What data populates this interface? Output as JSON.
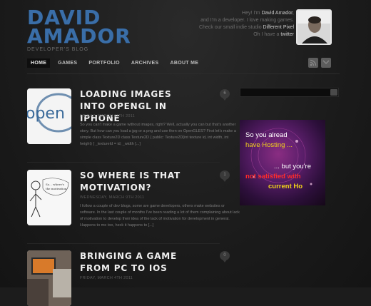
{
  "header": {
    "logo_line1": "DAVID",
    "logo_line2": "AMADOR",
    "tagline": "DEVELOPER'S BLOG",
    "intro_line1_a": "Hey! I'm ",
    "intro_line1_b": "David Amador",
    "intro_line1_c": ",",
    "intro_line2": "and I'm a developer. I love making games.",
    "intro_line3_a": "Check our small indie studio ",
    "intro_line3_b": "Different Pixel",
    "intro_line4_a": "Oh I have a ",
    "intro_line4_b": "twitter"
  },
  "nav": {
    "items": [
      "HOME",
      "GAMES",
      "PORTFOLIO",
      "ARCHIVES",
      "ABOUT ME"
    ],
    "active_index": 0
  },
  "social": {
    "icons": [
      "rss-icon",
      "mail-icon"
    ]
  },
  "posts": [
    {
      "title": "LOADING IMAGES INTO OPENGL IN IPHONE",
      "date": "FRIDAY, MARCH 11TH 2011",
      "excerpt": "So you can't make a game without images, right? Well, actually you can but that's another story. But how can you load a jpg or a png and use then on OpenGLES? First let's make a simple class Texture2D class Texture2D { public: Texture2D(int texture id, int width, int height) { _textureId = id; _width [...]",
      "comments": "6"
    },
    {
      "title": "SO WHERE IS THAT MOTIVATION?",
      "date": "WEDNESDAY, MARCH 9TH 2011",
      "excerpt": "I follow a couple of dev blogs, some are game developers, others make websites or software. In the last couple of months I've been reading a lot of them complaining about lack of motivation to develop their idea of the lack of motivation for development in general. Happens to me too, heck it happens to [...]",
      "comments": "1"
    },
    {
      "title": "BRINGING A GAME FROM PC TO IOS",
      "date": "FRIDAY, MARCH 4TH 2011",
      "excerpt": "",
      "comments": "0"
    }
  ],
  "thumbs": {
    "opengl_text": "open",
    "sketch_caption": "So... where's the motivation..."
  },
  "sidebar": {
    "ad_lines": [
      "So you alread",
      "have Hosting ...",
      "... but you're",
      "not satisfied with",
      "current Ho"
    ]
  },
  "colors": {
    "logo": "#3a6ea8",
    "background": "#1c1c1c",
    "ad_yellow": "#f2d21a",
    "ad_red": "#ff2a2a"
  }
}
